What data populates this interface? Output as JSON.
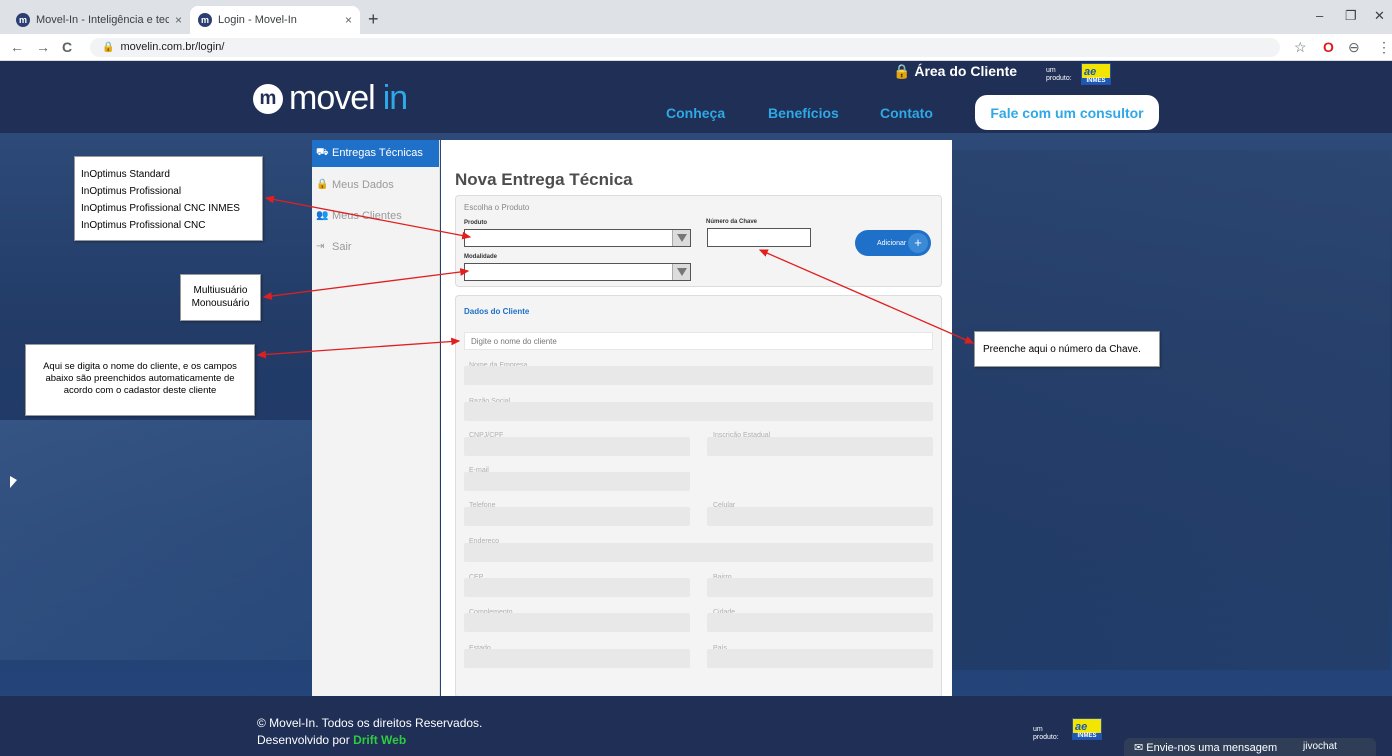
{
  "browser": {
    "tabs": [
      {
        "title": "Movel-In - Inteligência e tecnolo",
        "favicon": "m"
      },
      {
        "title": "Login - Movel-In",
        "favicon": "m"
      }
    ],
    "new_tab_label": "+",
    "tab_close": "×",
    "url": "movelin.com.br/login/",
    "nav": {
      "back": "←",
      "forward": "→",
      "reload": "C"
    },
    "window": {
      "minimize": "–",
      "restore": "❐",
      "close": "✕"
    },
    "ext": {
      "star": "☆",
      "opera": "O",
      "profile": "⊖",
      "menu": "⋮"
    }
  },
  "header": {
    "logo_main": "movel",
    "logo_accent": "in",
    "logo_badge": "m",
    "area_cliente": "Área do Cliente",
    "um_produto": [
      "um",
      "produto:"
    ],
    "inmes": "INMES",
    "nav": [
      "Conheça",
      "Benefícios",
      "Contato"
    ],
    "cta": "Fale com um consultor"
  },
  "sidebar": {
    "items": [
      {
        "label": "Entregas Técnicas",
        "icon": "truck-icon",
        "glyph": "⛟"
      },
      {
        "label": "Meus Dados",
        "icon": "lock-icon",
        "glyph": "🔒"
      },
      {
        "label": "Meus Clientes",
        "icon": "users-icon",
        "glyph": "👥"
      },
      {
        "label": "Sair",
        "icon": "logout-icon",
        "glyph": "⇥"
      }
    ]
  },
  "form": {
    "title": "Nova Entrega Técnica",
    "section1_legend": "Escolha o Produto",
    "produto_label": "Produto",
    "chave_label": "Número da Chave",
    "modalidade_label": "Modalidade",
    "add_button": "Adicionar",
    "add_plus": "+",
    "section2_title": "Dados do Cliente",
    "client_placeholder": "Digite o nome do cliente",
    "fields": {
      "empresa": "Nome da Empresa",
      "razao": "Razão Social",
      "cnpj": "CNPJ/CPF",
      "inscricao": "Inscrição Estadual",
      "email": "E-mail",
      "telefone": "Telefone",
      "celular": "Celular",
      "endereco": "Endereço",
      "cep": "CEP",
      "bairro": "Bairro",
      "complemento": "Complemento",
      "cidade": "Cidade",
      "estado": "Estado",
      "pais": "País"
    }
  },
  "annotations": {
    "products": [
      "InOptimus Standard",
      "InOptimus Profissional",
      "InOptimus Profissional CNC INMES",
      "InOptimus Profissional CNC"
    ],
    "modalidades": [
      "Multiusuário",
      "Monousuário"
    ],
    "client_note": [
      "Aqui se digita o nome do cliente, e os campos",
      "abaixo são preenchidos automaticamente de",
      "acordo com o cadastor deste cliente"
    ],
    "chave_note": "Preenche aqui o número da Chave."
  },
  "footer": {
    "copyright": "© Movel-In. Todos os direitos Reservados.",
    "dev_prefix": "Desenvolvido por ",
    "dev_name": "Drift Web",
    "chat": "Envie-nos uma mensagem",
    "chat_icon": "✉",
    "chat_brand": "jivochat"
  },
  "colors": {
    "header_bg": "#1f2f55",
    "accent": "#2ea8e6",
    "active_blue": "#1e70c8",
    "arrow_red": "#e02020"
  }
}
